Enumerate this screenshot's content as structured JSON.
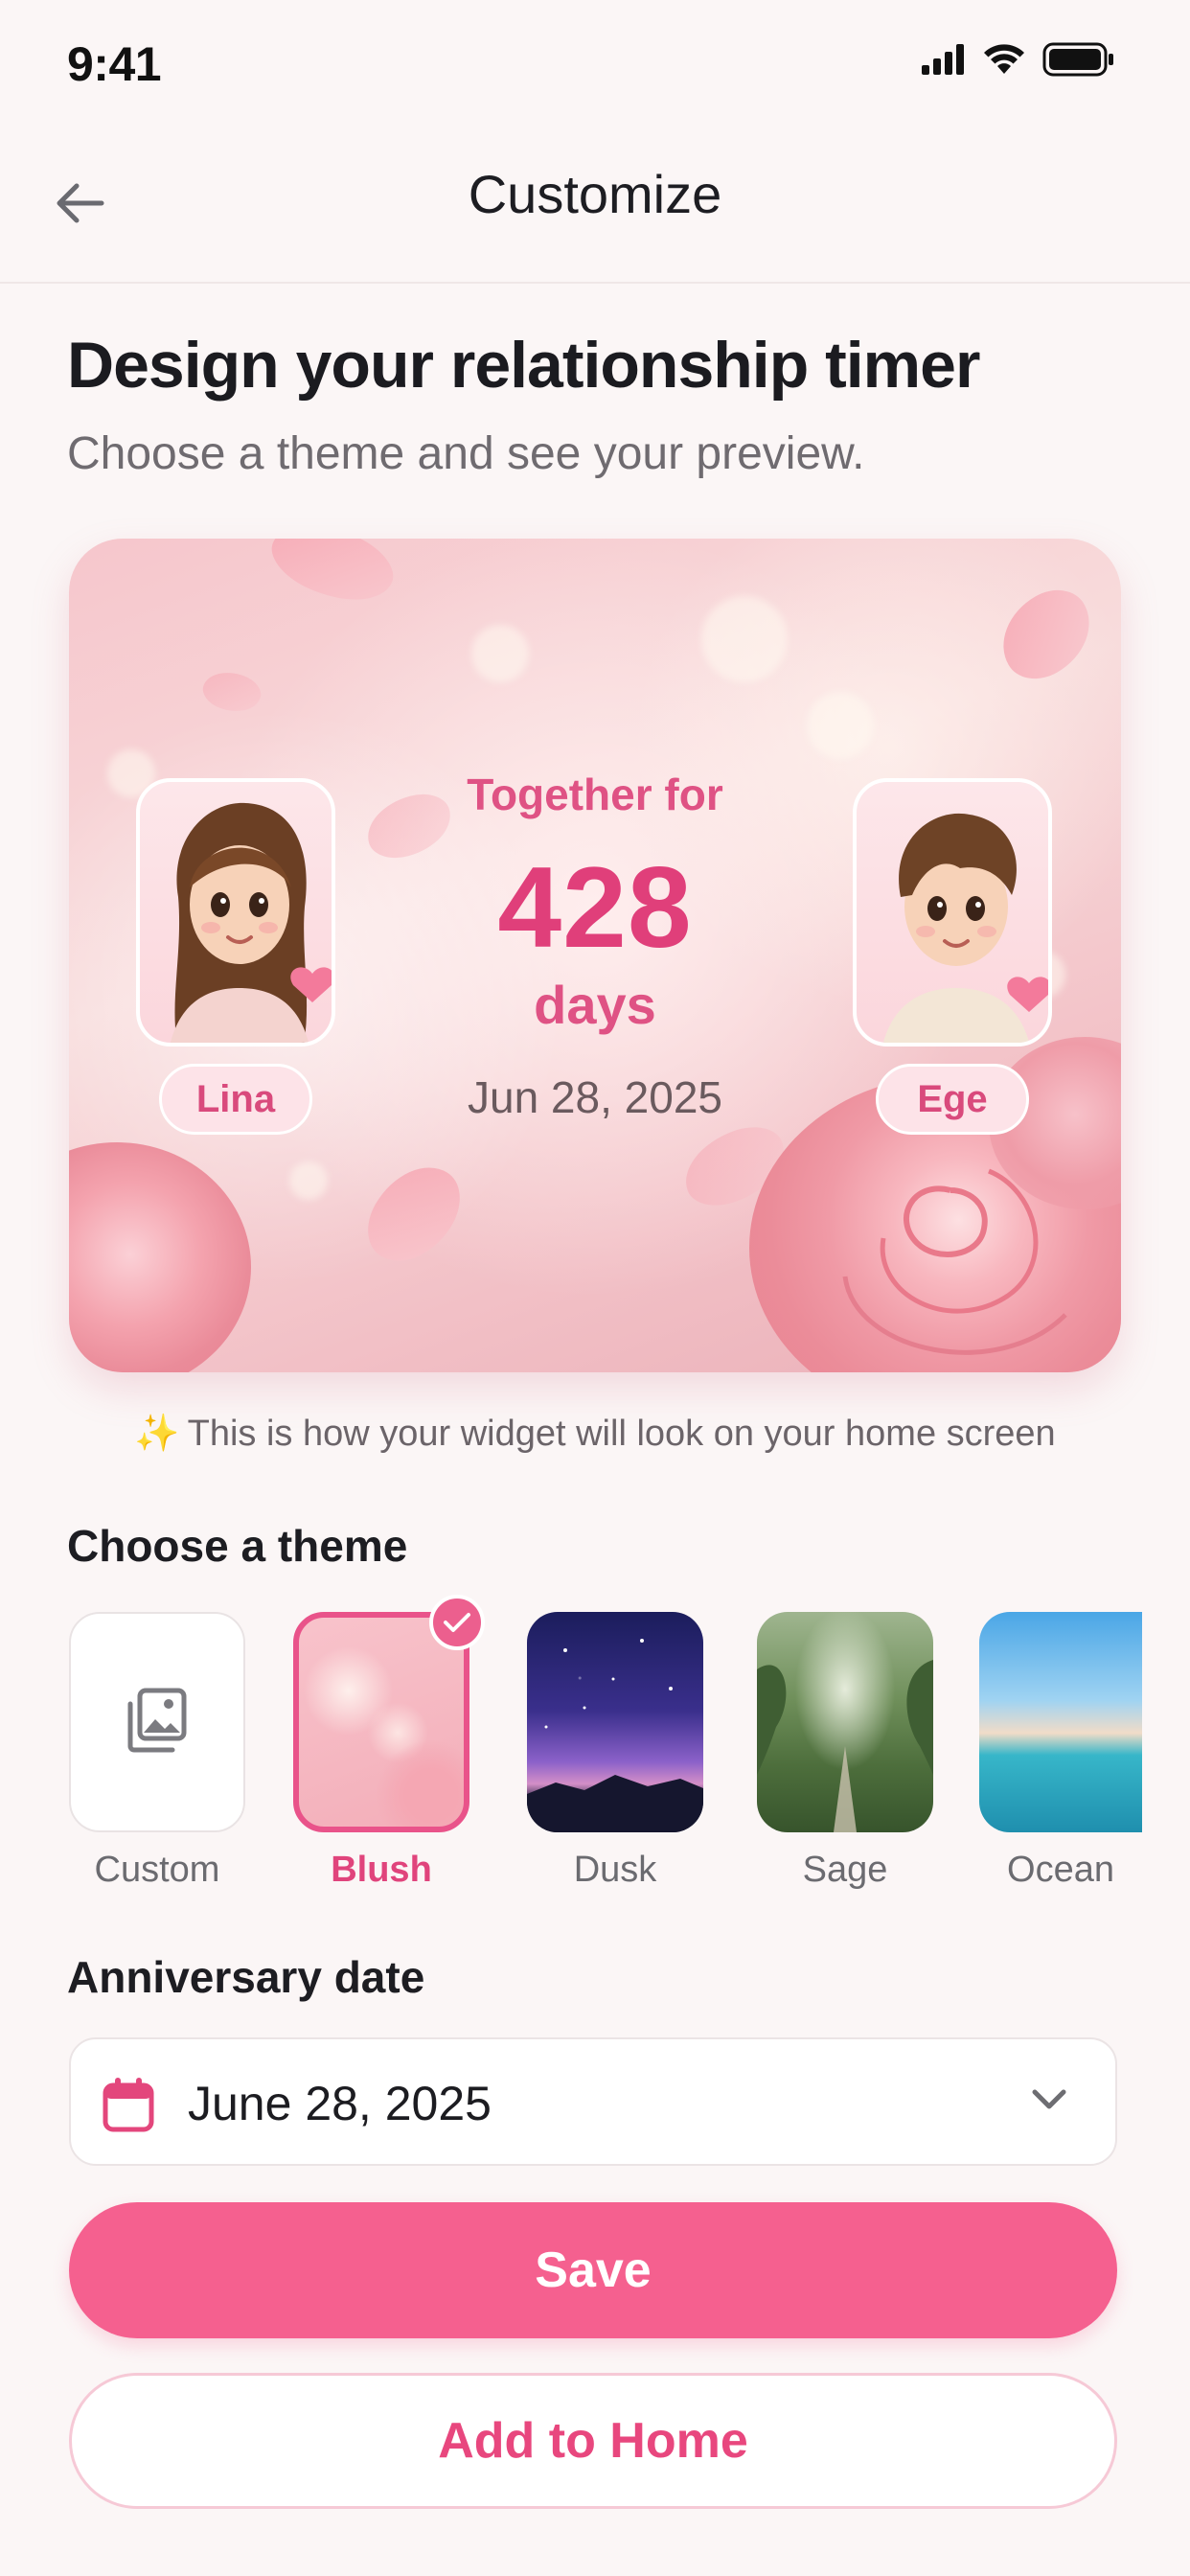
{
  "status_bar": {
    "time": "9:41",
    "icons": [
      "signal-icon",
      "wifi-icon",
      "battery-icon"
    ]
  },
  "nav": {
    "title": "Customize",
    "back_icon": "arrow-left-icon"
  },
  "header": {
    "title": "Design your relationship timer",
    "subtitle": "Choose a theme and see your preview."
  },
  "preview": {
    "partner_left": {
      "name": "Lina"
    },
    "partner_right": {
      "name": "Ege"
    },
    "together_label": "Together for",
    "days_count": "428",
    "days_label": "days",
    "start_date": "Jun 28, 2025"
  },
  "widget_note": {
    "icon": "sparkles-icon",
    "text": "This is how your widget will look on your home screen"
  },
  "themes": {
    "section_title": "Choose a theme",
    "selected": "Blush",
    "items": [
      {
        "label": "Custom",
        "icon": "gallery-icon"
      },
      {
        "label": "Blush"
      },
      {
        "label": "Dusk"
      },
      {
        "label": "Sage"
      },
      {
        "label": "Ocean"
      }
    ]
  },
  "anniversary": {
    "section_title": "Anniversary date",
    "value": "June 28, 2025",
    "icon": "calendar-icon",
    "dropdown_icon": "chevron-down-icon"
  },
  "actions": {
    "save_label": "Save",
    "add_home_label": "Add to Home"
  },
  "colors": {
    "accent": "#f5608f",
    "accent_text": "#e0447c",
    "background": "#fbf6f6"
  }
}
